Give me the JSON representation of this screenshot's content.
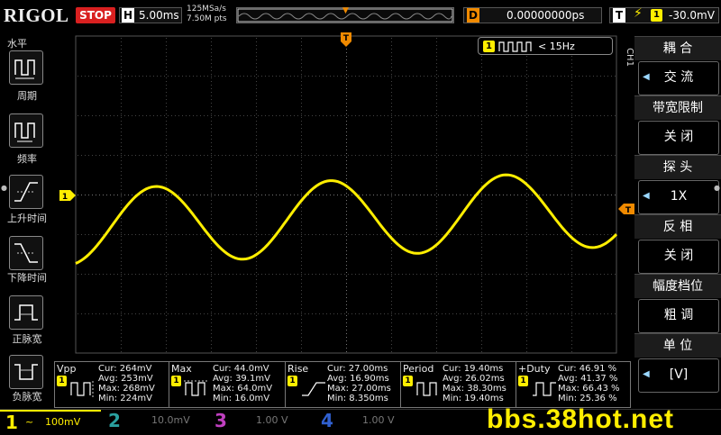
{
  "topbar": {
    "brand": "RIGOL",
    "run_state": "STOP",
    "horiz_letter": "H",
    "timebase": "5.00ms",
    "sample_rate": "125MSa/s",
    "memory_depth": "7.50M pts",
    "delay_letter": "D",
    "delay_offset": "0.00000000ps",
    "trigger_letter": "T",
    "trigger_channel": "1",
    "trigger_level": "-30.0mV"
  },
  "left_menu": {
    "title": "水平",
    "items": [
      {
        "label": "周期",
        "icon": "period-icon"
      },
      {
        "label": "频率",
        "icon": "frequency-icon"
      },
      {
        "label": "上升时间",
        "icon": "rise-time-icon"
      },
      {
        "label": "下降时间",
        "icon": "fall-time-icon"
      },
      {
        "label": "正脉宽",
        "icon": "positive-width-icon"
      },
      {
        "label": "负脉宽",
        "icon": "negative-width-icon"
      }
    ]
  },
  "screen": {
    "ch1_marker": "1",
    "freq_counter": "< 15Hz",
    "trigger_marker": "T",
    "trig_level_marker": "T"
  },
  "right_menu": {
    "channel": "CH1",
    "items": [
      {
        "title": "耦 合",
        "value": "交 流"
      },
      {
        "title": "带宽限制",
        "value": "关 闭"
      },
      {
        "title": "探 头",
        "value": "1X"
      },
      {
        "title": "反 相",
        "value": "关 闭"
      },
      {
        "title": "幅度档位",
        "value": "粗 调"
      },
      {
        "title": "单 位",
        "value": "[V]"
      }
    ]
  },
  "measurements": [
    {
      "name": "Vpp",
      "ch": "1",
      "cur": "Cur: 264mV",
      "avg": "Avg: 253mV",
      "max": "Max: 268mV",
      "min": "Min: 224mV"
    },
    {
      "name": "Max",
      "ch": "1",
      "cur": "Cur: 44.0mV",
      "avg": "Avg: 39.1mV",
      "max": "Max: 64.0mV",
      "min": "Min: 16.0mV"
    },
    {
      "name": "Rise",
      "ch": "1",
      "cur": "Cur: 27.00ms",
      "avg": "Avg: 16.90ms",
      "max": "Max: 27.00ms",
      "min": "Min: 8.350ms"
    },
    {
      "name": "Period",
      "ch": "1",
      "cur": "Cur: 19.40ms",
      "avg": "Avg: 26.02ms",
      "max": "Max: 38.30ms",
      "min": "Min: 19.40ms"
    },
    {
      "name": "+Duty",
      "ch": "1",
      "cur": "Cur: 46.91 %",
      "avg": "Avg: 41.37 %",
      "max": "Max: 66.43 %",
      "min": "Min: 25.36 %"
    }
  ],
  "channels": [
    {
      "num": "1",
      "scale": "100mV",
      "coupling_icon": "~",
      "color": "#ffee00"
    },
    {
      "num": "2",
      "scale": "10.0mV",
      "color": "#2aa0a0"
    },
    {
      "num": "3",
      "scale": "1.00 V",
      "color": "#c040c0"
    },
    {
      "num": "4",
      "scale": "1.00 V",
      "color": "#3060d0"
    }
  ],
  "watermark": "bbs.38hot.net",
  "colors": {
    "ch1": "#ffee00",
    "trigger": "#f08a00",
    "stop": "#d92020"
  }
}
